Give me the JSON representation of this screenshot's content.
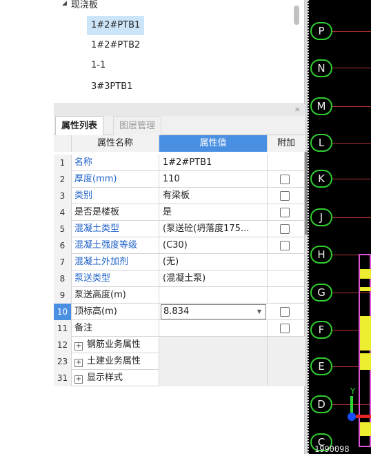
{
  "tree": {
    "group_label": "现浇板",
    "items": [
      "1#2#PTB1",
      "1#2#PTB2",
      "1-1",
      "3#3PTB1"
    ],
    "selected_index": 0
  },
  "panel": {
    "close_glyph": "×"
  },
  "tabs": [
    "属性列表",
    "图层管理"
  ],
  "table": {
    "headers": [
      "属性名称",
      "属性值",
      "附加"
    ],
    "rows": [
      {
        "idx": "1",
        "name": "名称",
        "value": "1#2#PTB1",
        "checkbox": false
      },
      {
        "idx": "2",
        "name": "厚度(mm)",
        "value": "110",
        "checkbox": true
      },
      {
        "idx": "3",
        "name": "类别",
        "value": "有梁板",
        "checkbox": true
      },
      {
        "idx": "4",
        "name": "是否是楼板",
        "value": "是",
        "checkbox": true
      },
      {
        "idx": "5",
        "name": "混凝土类型",
        "value": "(泵送砼(坍落度175...",
        "checkbox": true
      },
      {
        "idx": "6",
        "name": "混凝土强度等级",
        "value": "(C30)",
        "checkbox": true
      },
      {
        "idx": "7",
        "name": "混凝土外加剂",
        "value": "(无)",
        "checkbox": false
      },
      {
        "idx": "8",
        "name": "泵送类型",
        "value": "(混凝土泵)",
        "checkbox": false
      },
      {
        "idx": "9",
        "name": "泵送高度(m)",
        "value": "",
        "checkbox": false
      },
      {
        "idx": "10",
        "name": "顶标高(m)",
        "value": "8.834",
        "checkbox": true
      },
      {
        "idx": "11",
        "name": "备注",
        "value": "",
        "checkbox": true
      },
      {
        "idx": "12",
        "name": "钢筋业务属性",
        "value": "",
        "checkbox": false
      },
      {
        "idx": "23",
        "name": "土建业务属性",
        "value": "",
        "checkbox": false
      },
      {
        "idx": "31",
        "name": "显示样式",
        "value": "",
        "checkbox": false
      }
    ]
  },
  "cad": {
    "axis_labels": [
      "P",
      "N",
      "M",
      "L",
      "K",
      "J",
      "H",
      "G",
      "F",
      "E",
      "D",
      "C"
    ],
    "coord_text": "1990098",
    "y_label": "Y"
  },
  "colors": {
    "accent": "#4a90e2",
    "selection": "#cce4f7",
    "link_blue": "#1f62c9",
    "axis_green": "#2fcf2f",
    "pink": "#e055d8",
    "yellow": "#eeee30"
  }
}
